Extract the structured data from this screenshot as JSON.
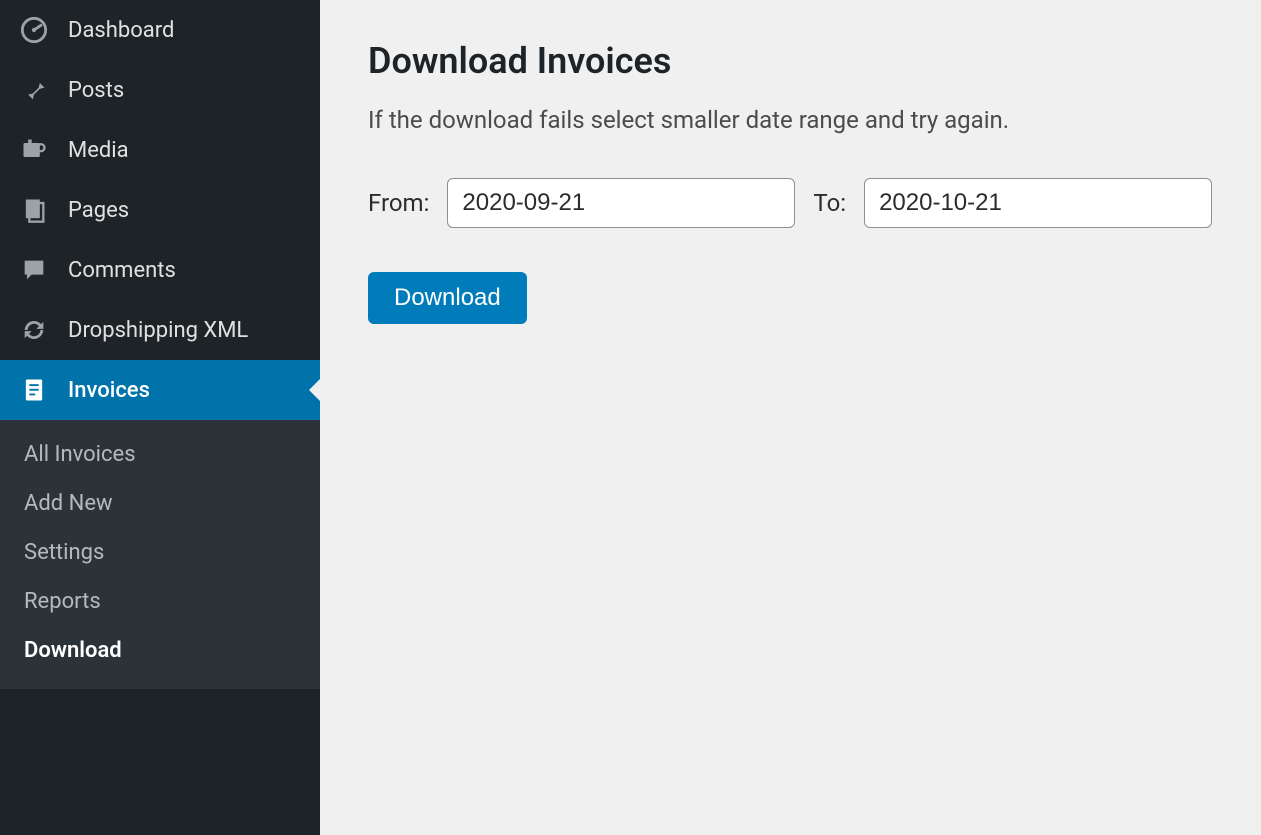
{
  "sidebar": {
    "items": [
      {
        "label": "Dashboard",
        "icon": "dashboard"
      },
      {
        "label": "Posts",
        "icon": "pin"
      },
      {
        "label": "Media",
        "icon": "media"
      },
      {
        "label": "Pages",
        "icon": "pages"
      },
      {
        "label": "Comments",
        "icon": "comment"
      },
      {
        "label": "Dropshipping XML",
        "icon": "sync"
      },
      {
        "label": "Invoices",
        "icon": "invoice"
      }
    ],
    "submenu": [
      {
        "label": "All Invoices"
      },
      {
        "label": "Add New"
      },
      {
        "label": "Settings"
      },
      {
        "label": "Reports"
      },
      {
        "label": "Download"
      }
    ]
  },
  "page": {
    "title": "Download Invoices",
    "description": "If the download fails select smaller date range and try again.",
    "from_label": "From:",
    "to_label": "To:",
    "from_value": "2020-09-21",
    "to_value": "2020-10-21",
    "download_label": "Download"
  }
}
